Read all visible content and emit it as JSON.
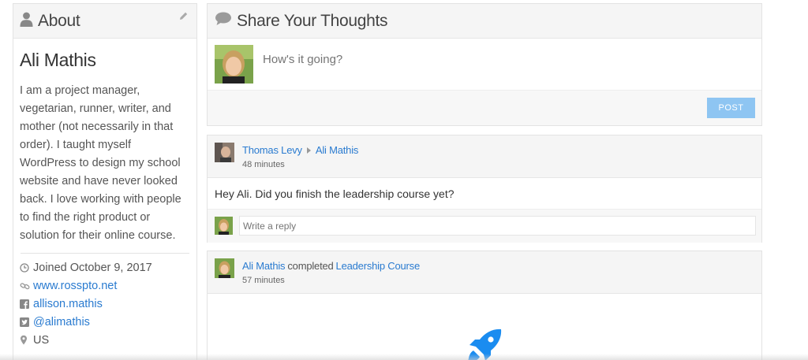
{
  "about": {
    "title": "About",
    "name": "Ali Mathis",
    "bio": "I am a project manager, vegetarian, runner, writer, and mother (not necessarily in that order). I taught myself WordPress to design my school website and have never looked back. I love working with people to find the right product or solution for their online course.",
    "joined": "Joined October 9, 2017",
    "website": "www.rosspto.net",
    "facebook": "allison.mathis",
    "twitter": "@alimathis",
    "location": "US",
    "icons": [
      "user-icon",
      "pencil-icon",
      "clock-icon",
      "link-icon",
      "facebook-icon",
      "twitter-icon",
      "location-pin-icon"
    ]
  },
  "share": {
    "title": "Share Your Thoughts",
    "placeholder": "How's it going?",
    "post_label": "POST",
    "icon": "speech-bubble-icon"
  },
  "activity1": {
    "author": "Thomas Levy",
    "target": "Ali Mathis",
    "time": "48 minutes",
    "message": "Hey Ali.  Did you finish the leadership course yet?",
    "reply_placeholder": "Write a reply"
  },
  "activity2": {
    "author": "Ali Mathis",
    "verb": "completed",
    "course": "Leadership Course",
    "time": "57 minutes",
    "icon": "rocket-icon"
  },
  "colors": {
    "link": "#2a7bd0",
    "post_button": "#8ec5f2",
    "rocket": "#1a8cf0",
    "panel_header": "#f5f5f5"
  }
}
